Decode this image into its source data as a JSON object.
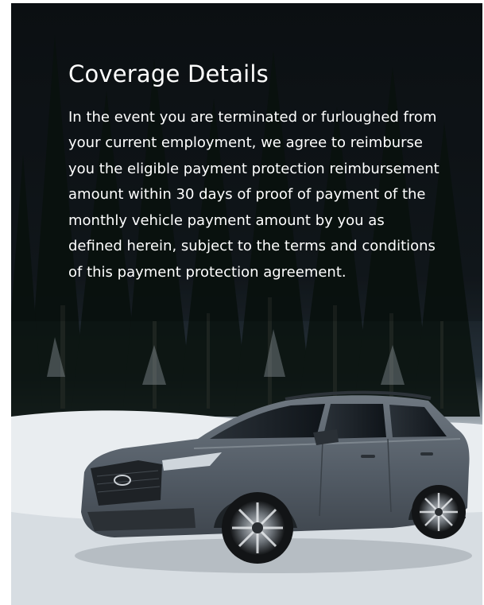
{
  "coverage": {
    "title": "Coverage Details",
    "body": "In the event you are terminated or furloughed from your current employment, we agree to reimburse you the eligible payment protection reimbursement amount within 30 days of proof of payment of the monthly vehicle payment amount by you as defined herein, subject to the terms and conditions of this payment protection agreement."
  },
  "colors": {
    "text": "#ffffff",
    "vehicle": "#5b646d",
    "snow": "#e9edf0",
    "forest": "#0f1b17"
  }
}
